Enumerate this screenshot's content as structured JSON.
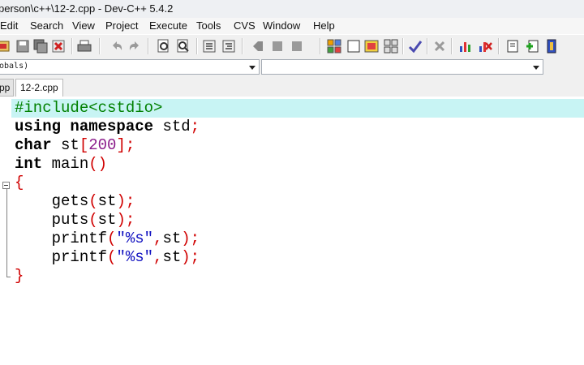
{
  "window": {
    "title": "person\\c++\\12-2.cpp - Dev-C++ 5.4.2"
  },
  "menu": [
    "Edit",
    "Search",
    "View",
    "Project",
    "Execute",
    "Tools",
    "CVS",
    "Window",
    "Help"
  ],
  "combos": {
    "scope": "obals)",
    "members": ""
  },
  "tabs": [
    {
      "label": "pp"
    },
    {
      "label": "12-2.cpp"
    }
  ],
  "code": {
    "line1": {
      "a": "#include<cstdio>"
    },
    "line2": {
      "kw1": "using",
      "sp1": " ",
      "kw2": "namespace",
      "rest": " std",
      "semi": ";"
    },
    "line3": {
      "kw": "char",
      "id": " st",
      "lb": "[",
      "num": "200",
      "rb": "]",
      "semi": ";"
    },
    "line4": {
      "kw": "int",
      "id": " main",
      "parens": "()"
    },
    "line5": {
      "brace": "{"
    },
    "line6": {
      "indent": "    ",
      "fn": "gets",
      "lp": "(",
      "arg": "st",
      "rp": ")",
      "semi": ";"
    },
    "line7": {
      "indent": "    ",
      "fn": "puts",
      "lp": "(",
      "arg": "st",
      "rp": ")",
      "semi": ";"
    },
    "line8": {
      "indent": "    ",
      "fn": "printf",
      "lp": "(",
      "str": "\"%s\"",
      "comma": ",",
      "arg": "st",
      "rp": ")",
      "semi": ";"
    },
    "line9": {
      "indent": "    ",
      "fn": "printf",
      "lp": "(",
      "str": "\"%s\"",
      "comma": ",",
      "arg": "st",
      "rp": ")",
      "semi": ";"
    },
    "line10": {
      "brace": "}"
    }
  },
  "colors": {
    "keyword": "#000000",
    "preprocessor": "#008000",
    "symbol": "#d00000",
    "number": "#8a1a8a",
    "string": "#1010c0",
    "active_line": "#c8f4f4"
  }
}
